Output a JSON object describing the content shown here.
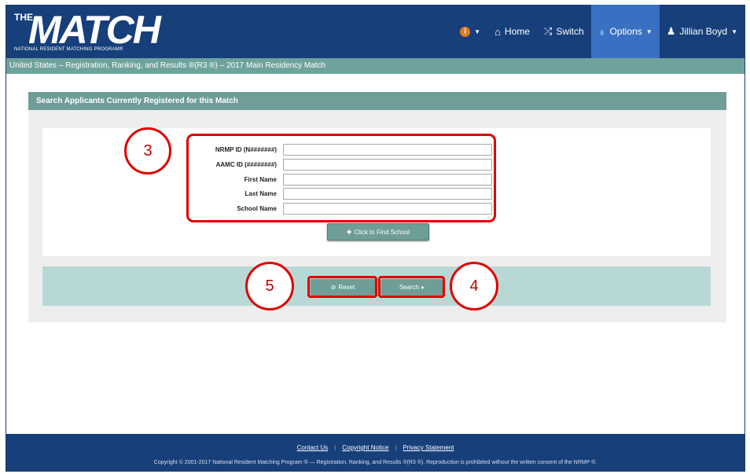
{
  "header": {
    "logo_the": "THE",
    "logo_match": "MATCH",
    "logo_sub": "NATIONAL RESIDENT MATCHING PROGRAM®",
    "nav": {
      "home": "Home",
      "switch": "Switch",
      "options": "Options",
      "user": "Jillian Boyd"
    }
  },
  "breadcrumb": "United States  –  Registration, Ranking, and Results ®(R3 ®)  –  2017 Main Residency Match",
  "panel": {
    "title": "Search Applicants Currently Registered for this Match",
    "fields": [
      {
        "label": "NRMP ID (N#######)",
        "value": ""
      },
      {
        "label": "AAMC ID (########)",
        "value": ""
      },
      {
        "label": "First Name",
        "value": ""
      },
      {
        "label": "Last Name",
        "value": ""
      },
      {
        "label": "School Name",
        "value": ""
      }
    ],
    "find_school": "Click to Find School",
    "reset": "Reset",
    "search": "Search"
  },
  "annotations": {
    "c3": "3",
    "c4": "4",
    "c5": "5",
    "color": "#e00000"
  },
  "footer": {
    "contact": "Contact Us",
    "copyright_notice": "Copyright Notice",
    "privacy": "Privacy Statement",
    "copyright": "Copyright © 2001-2017 National Resident Matching Program ®  —  Registration, Ranking, and Results ®(R3 ®). Reproduction is prohibited without the written consent of the NRMP ®."
  },
  "colors": {
    "header": "#173f7a",
    "teal": "#6f9d97",
    "active_nav": "#3a70c2"
  }
}
